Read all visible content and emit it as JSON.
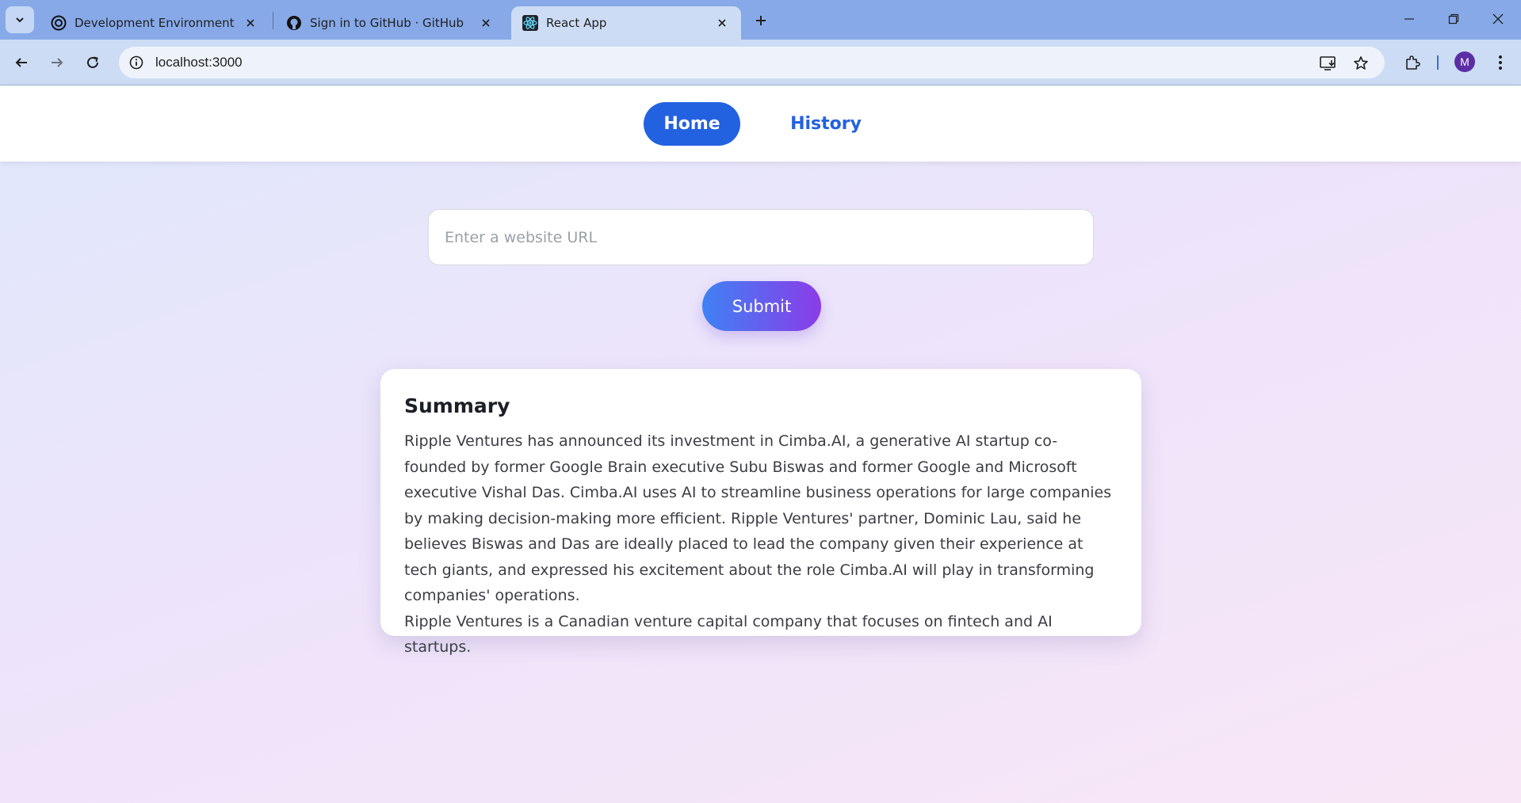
{
  "browser": {
    "tabs": [
      {
        "title": "Development Environment Setu",
        "favicon": "openai-icon",
        "active": false
      },
      {
        "title": "Sign in to GitHub · GitHub",
        "favicon": "github-icon",
        "active": false
      },
      {
        "title": "React App",
        "favicon": "react-icon",
        "active": true
      }
    ],
    "url": "localhost:3000",
    "profile_initial": "M",
    "accent_color": "#2261e0"
  },
  "app": {
    "nav": {
      "home_label": "Home",
      "history_label": "History",
      "active": "Home"
    },
    "form": {
      "url_placeholder": "Enter a website URL",
      "url_value": "",
      "submit_label": "Submit"
    },
    "summary": {
      "heading": "Summary",
      "paragraphs": [
        "Ripple Ventures has announced its investment in Cimba.AI, a generative AI startup co-founded by former Google Brain executive Subu Biswas and former Google and Microsoft executive Vishal Das. Cimba.AI uses AI to streamline business operations for large companies by making decision-making more efficient. Ripple Ventures' partner, Dominic Lau, said he believes Biswas and Das are ideally placed to lead the company given their experience at tech giants, and expressed his excitement about the role Cimba.AI will play in transforming companies' operations.",
        "Ripple Ventures is a Canadian venture capital company that focuses on fintech and AI startups."
      ]
    }
  }
}
